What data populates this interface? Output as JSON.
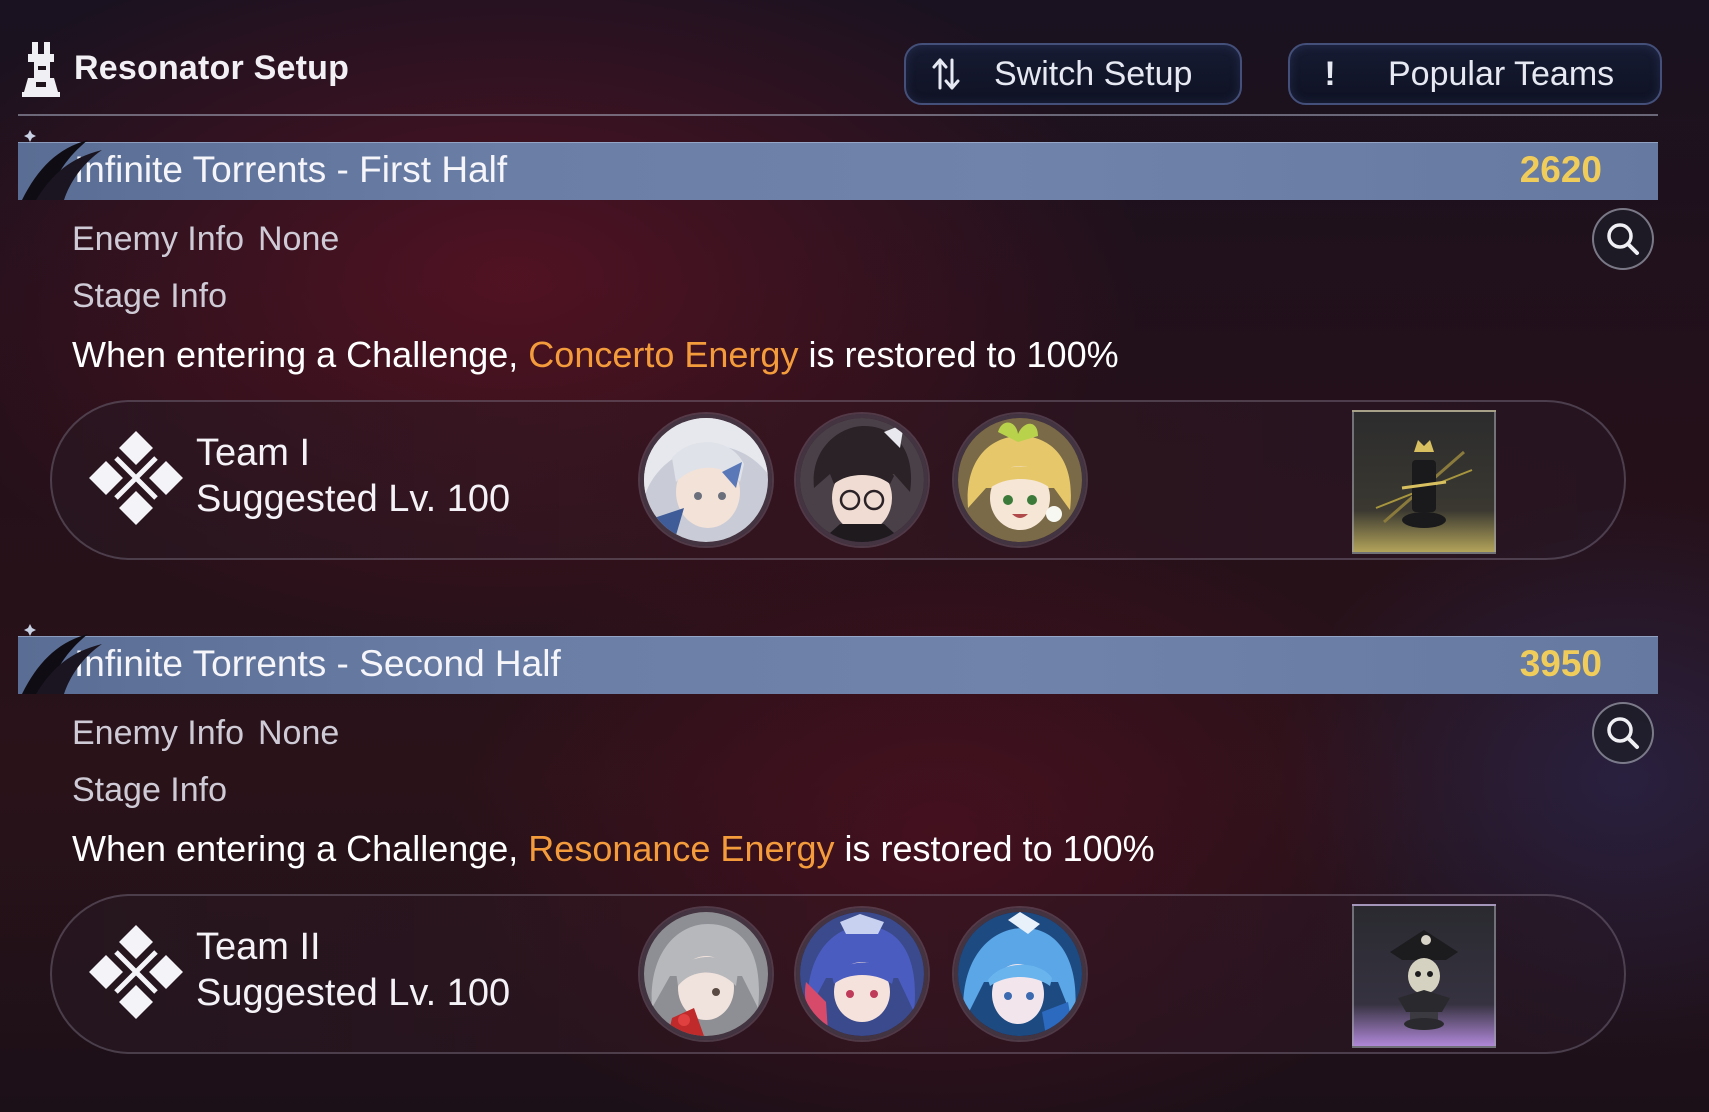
{
  "header": {
    "title": "Resonator Setup",
    "switch_setup_label": "Switch Setup",
    "popular_teams_label": "Popular Teams",
    "popular_teams_icon_glyph": "!"
  },
  "sections": [
    {
      "title": "Infinite Torrents - First Half",
      "score": "2620",
      "enemy_info_label": "Enemy Info",
      "enemy_info_value": "None",
      "stage_info_label": "Stage Info",
      "stage_desc_prefix": "When entering a Challenge, ",
      "stage_desc_highlight": "Concerto Energy",
      "stage_desc_suffix": " is restored to 100%",
      "team_name": "Team I",
      "suggested_level": "Suggested Lv. 100",
      "echo_tint": "gold"
    },
    {
      "title": "Infinite Torrents - Second Half",
      "score": "3950",
      "enemy_info_label": "Enemy Info",
      "enemy_info_value": "None",
      "stage_info_label": "Stage Info",
      "stage_desc_prefix": "When entering a Challenge, ",
      "stage_desc_highlight": "Resonance Energy",
      "stage_desc_suffix": " is restored to 100%",
      "team_name": "Team II",
      "suggested_level": "Suggested Lv. 100",
      "echo_tint": "purple"
    }
  ],
  "colors": {
    "score": "#f0cc5a",
    "highlight": "#f49c3c",
    "banner": "#6a7ea6",
    "button_border": "#44507a"
  },
  "icons": {
    "header": "tower-icon",
    "switch": "swap-arrows-icon",
    "popular": "exclamation-icon",
    "search": "magnifier-icon",
    "team": "diamond-emblem-icon"
  }
}
